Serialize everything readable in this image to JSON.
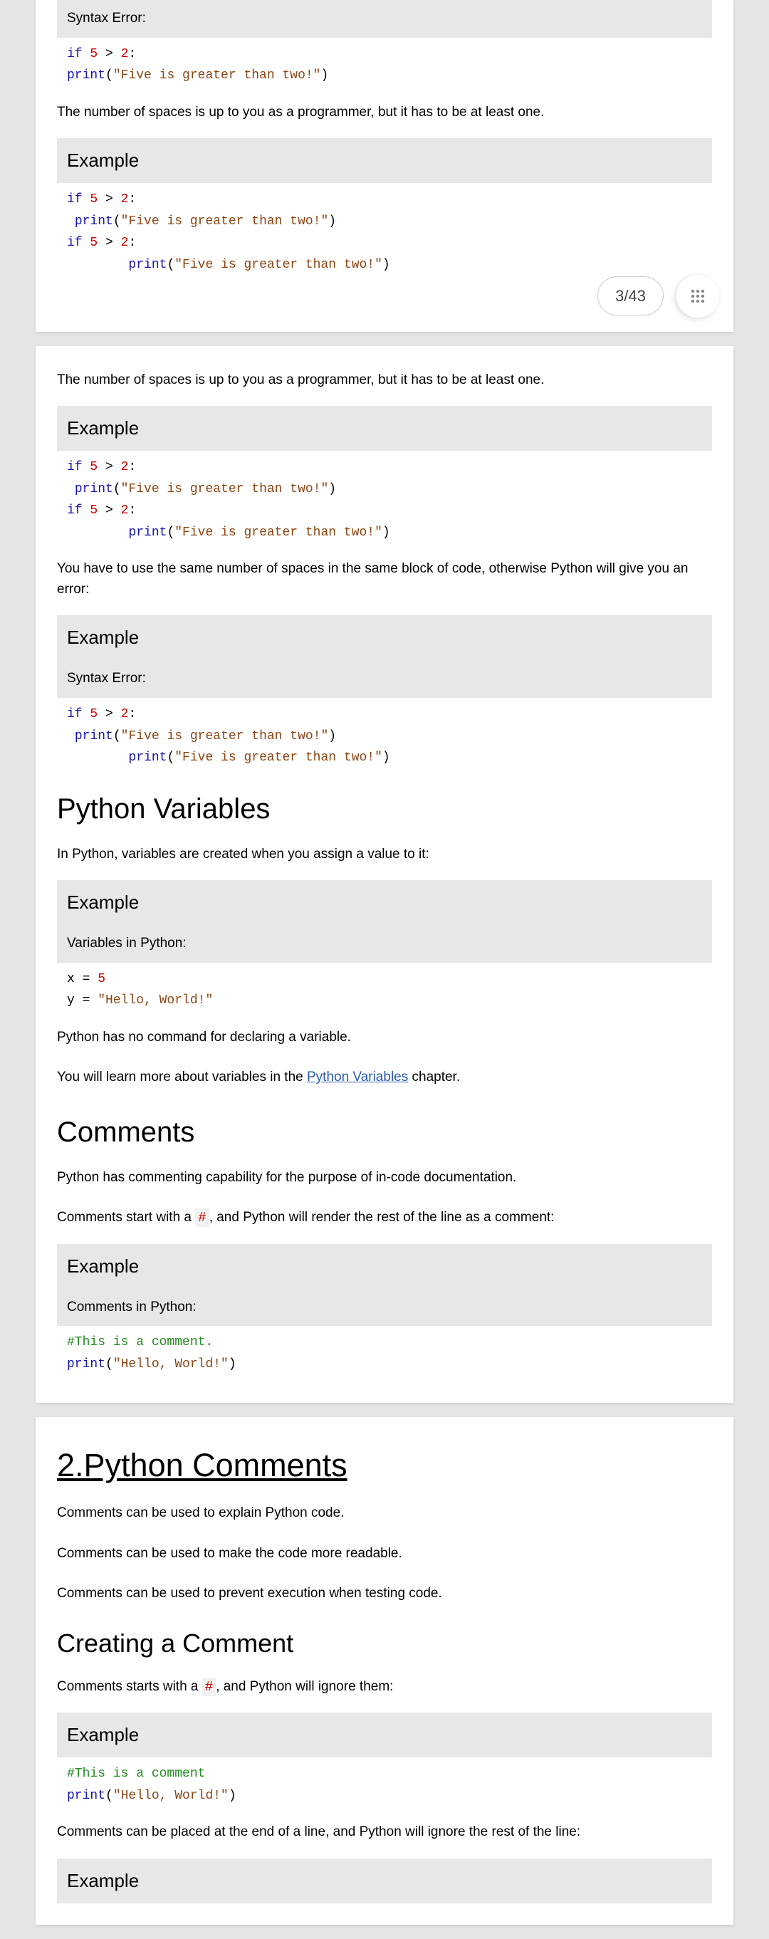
{
  "labels": {
    "example": "Example",
    "syntax_error": "Syntax Error:"
  },
  "page_counter": "3/43",
  "p1": {
    "code1": {
      "l1_kw": "if",
      "l1_rest": " ",
      "l1_num": "5",
      "l1_op": " > ",
      "l1_num2": "2",
      "l1_colon": ":",
      "l2_fn": "print",
      "l2_open": "(",
      "l2_str": "\"Five is greater than two!\"",
      "l2_close": ")"
    },
    "para1": "The number of spaces is up to you as a programmer, but it has to be at least one.",
    "code2": {
      "l1_kw": "if",
      "l1_num": "5",
      "l1_num2": "2",
      "l2_fn": "print",
      "l2_str": "\"Five is greater than two!\"",
      "l3_kw": "if",
      "l3_num": "5",
      "l3_num2": "2",
      "l4_fn": "print",
      "l4_str": "\"Five is greater than two!\""
    }
  },
  "p2": {
    "para1": "The number of spaces is up to you as a programmer, but it has to be at least one.",
    "code1": {
      "l1_kw": "if",
      "l1_num": "5",
      "l1_num2": "2",
      "l2_fn": "print",
      "l2_str": "\"Five is greater than two!\"",
      "l3_kw": "if",
      "l3_num": "5",
      "l3_num2": "2",
      "l4_fn": "print",
      "l4_str": "\"Five is greater than two!\""
    },
    "para2": "You have to use the same number of spaces in the same block of code, otherwise Python will give you an error:",
    "code2": {
      "l1_kw": "if",
      "l1_num": "5",
      "l1_num2": "2",
      "l2_fn": "print",
      "l2_str": "\"Five is greater than two!\"",
      "l3_fn": "print",
      "l3_str": "\"Five is greater than two!\""
    },
    "h_vars": "Python Variables",
    "para3": "In Python, variables are created when you assign a value to it:",
    "vars_sub": "Variables in Python:",
    "code3": {
      "l1_var": "x = ",
      "l1_num": "5",
      "l2_var": "y = ",
      "l2_str": "\"Hello, World!\""
    },
    "para4": "Python has no command for declaring a variable.",
    "para5_a": "You will learn more about variables in the ",
    "para5_link": "Python Variables",
    "para5_b": " chapter.",
    "h_comments": "Comments",
    "para6": "Python has commenting capability for the purpose of in-code documentation.",
    "para7_a": "Comments start with a ",
    "para7_hash": "#",
    "para7_b": ", and Python will render the rest of the line as a comment:",
    "comments_sub": "Comments in Python:",
    "code4": {
      "l1_comment": "#This is a comment.",
      "l2_fn": "print",
      "l2_str": "\"Hello, World!\""
    }
  },
  "p3": {
    "h_title": "2.Python Comments",
    "para1": "Comments can be used to explain Python code.",
    "para2": "Comments can be used to make the code more readable.",
    "para3": "Comments can be used to prevent execution when testing code.",
    "h_create": "Creating a Comment",
    "para4_a": "Comments starts with a ",
    "para4_hash": "#",
    "para4_b": ", and Python will ignore them:",
    "code1": {
      "l1_comment": "#This is a comment",
      "l2_fn": "print",
      "l2_str": "\"Hello, World!\""
    },
    "para5": "Comments can be placed at the end of a line, and Python will ignore the rest of the line:"
  }
}
